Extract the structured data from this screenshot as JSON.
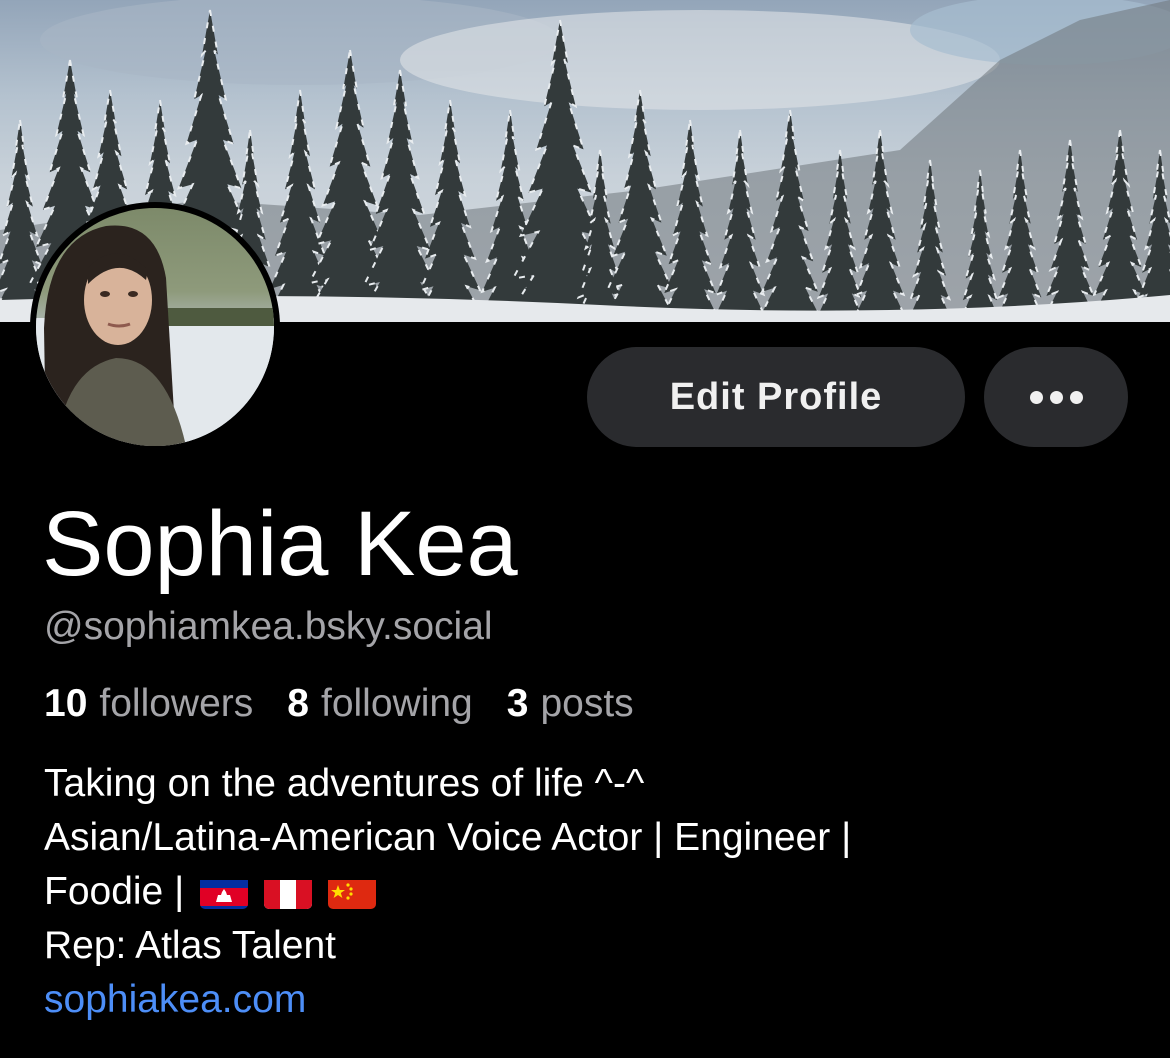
{
  "banner": {
    "alt": "snowy-forest-banner"
  },
  "avatar": {
    "alt": "profile-photo"
  },
  "actions": {
    "edit_profile_label": "Edit Profile",
    "more_label": "more-options"
  },
  "profile": {
    "display_name": "Sophia Kea",
    "handle": "@sophiamkea.bsky.social"
  },
  "stats": {
    "followers_count": "10",
    "followers_label": "followers",
    "following_count": "8",
    "following_label": "following",
    "posts_count": "3",
    "posts_label": "posts"
  },
  "bio": {
    "line1": "Taking on the adventures of life ^-^",
    "line2": "Asian/Latina-American Voice Actor | Engineer |",
    "line3": "Foodie |",
    "flags": [
      "cambodia-flag",
      "peru-flag",
      "china-flag"
    ],
    "line4": "Rep: Atlas Talent",
    "link": "sophiakea.com"
  },
  "colors": {
    "background": "#000000",
    "button_bg": "#2a2b2e",
    "secondary_text": "#a4a4a8",
    "link": "#4d8ef7"
  }
}
